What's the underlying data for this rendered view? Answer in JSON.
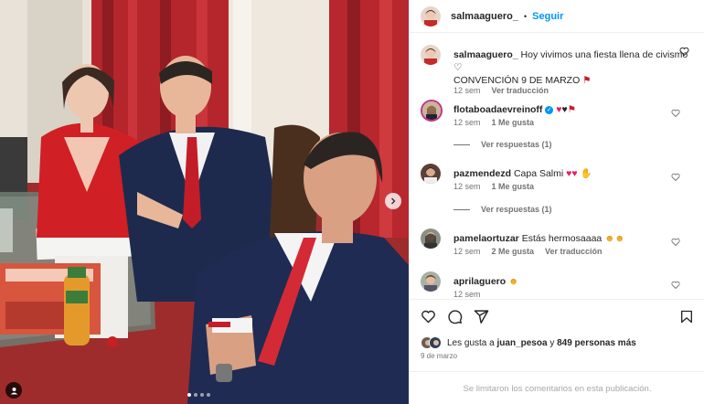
{
  "post": {
    "username": "salmaaguero_",
    "separator": "•",
    "follow_label": "Seguir",
    "media_total_slides": 4,
    "media_active_slide": 1
  },
  "caption": {
    "username": "salmaaguero_",
    "text": "Hoy vivimos una fiesta llena de civismo",
    "text2": "CONVENCIÓN 9 DE MARZO",
    "time": "12 sem",
    "translate_label": "Ver traducción"
  },
  "comments": [
    {
      "username": "flotaboadaevreinoff",
      "text": "",
      "time": "12 sem",
      "likes": "1 Me gusta",
      "replies_label": "Ver respuestas (1)"
    },
    {
      "username": "pazmendezd",
      "text": "Capa Salmi",
      "time": "12 sem",
      "likes": "1 Me gusta",
      "replies_label": "Ver respuestas (1)"
    },
    {
      "username": "pamelaortuzar",
      "text": "Estás hermosaaaa",
      "time": "12 sem",
      "likes": "2 Me gusta",
      "translate_label": "Ver traducción"
    },
    {
      "username": "aprilaguero",
      "text": "",
      "time": "12 sem"
    }
  ],
  "likes": {
    "prefix": "Les gusta a",
    "user": "juan_pesoa",
    "middle": "y",
    "count": "849 personas más"
  },
  "date": "9 de marzo",
  "comments_closed": "Se limitaron los comentarios en esta publicación.",
  "colors": {
    "link": "#0095f6",
    "muted": "#737373",
    "heart_red": "#e0245e",
    "verified": "#0095f6"
  }
}
